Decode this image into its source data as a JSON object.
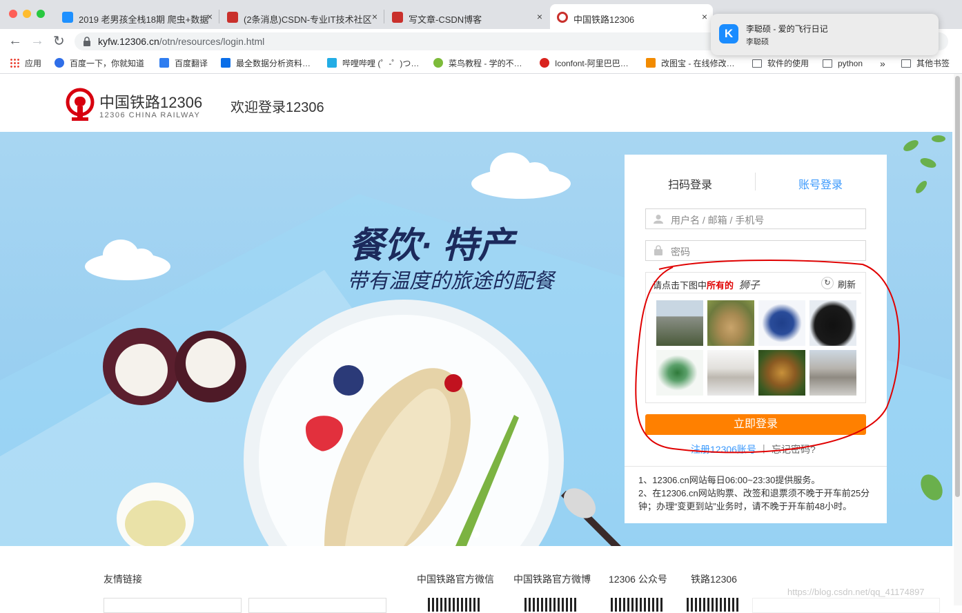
{
  "browser": {
    "tabs": [
      {
        "title": "2019 老男孩全栈18期 爬虫+数据",
        "close": "×",
        "favicon_color": "#1e90ff"
      },
      {
        "title": "(2条消息)CSDN-专业IT技术社区",
        "close": "×",
        "favicon_color": "#c9302c"
      },
      {
        "title": "写文章-CSDN博客",
        "close": "×",
        "favicon_color": "#c9302c"
      },
      {
        "title": "中国铁路12306",
        "close": "×",
        "favicon_color": "#c9302c"
      }
    ],
    "url_host": "kyfw.12306.cn",
    "url_path": "/otn/resources/login.html",
    "bookmarks": [
      {
        "label": "应用",
        "icon": "apps-grid-icon"
      },
      {
        "label": "百度一下，你就知道",
        "icon": "baidu-paw-icon"
      },
      {
        "label": "百度翻译",
        "icon": "translate-icon"
      },
      {
        "label": "最全数据分析资料…",
        "icon": "zhihu-icon"
      },
      {
        "label": "哔哩哔哩 (゜-゜)つ…",
        "icon": "bilibili-icon"
      },
      {
        "label": "菜鸟教程 - 学的不…",
        "icon": "runoob-icon"
      },
      {
        "label": "Iconfont-阿里巴巴…",
        "icon": "iconfont-icon"
      },
      {
        "label": "改图宝 - 在线修改…",
        "icon": "gaitubao-icon"
      },
      {
        "label": "软件的使用",
        "icon": "folder-icon"
      },
      {
        "label": "python",
        "icon": "folder-icon"
      }
    ],
    "bookmarks_more": "»",
    "other_bookmarks": "其他书签"
  },
  "notification": {
    "title": "李聪硕 - 爱的飞行日记",
    "subtitle": "李聪硕",
    "app_icon_letter": "K"
  },
  "header": {
    "logo_cn": "中国铁路12306",
    "logo_en": "12306 CHINA RAILWAY",
    "welcome": "欢迎登录12306"
  },
  "banner": {
    "headline": "餐饮· 特产",
    "tagline": "带有温度的旅途的配餐"
  },
  "login": {
    "tab_qr": "扫码登录",
    "tab_account": "账号登录",
    "username_placeholder": "用户名 / 邮箱 / 手机号",
    "password_placeholder": "密码",
    "captcha_prompt": "请点击下图中",
    "captcha_emph": "所有的",
    "captcha_target": "狮子",
    "refresh": "刷新",
    "submit": "立即登录",
    "register": "注册12306账号",
    "divider": "|",
    "forgot": "忘记密码?",
    "notices": [
      "1、12306.cn网站每日06:00~23:30提供服务。",
      "2、在12306.cn网站购票、改签和退票须不晚于开车前25分",
      "钟；办理“变更到站”业务时，请不晚于开车前48小时。"
    ]
  },
  "footer": {
    "links_title": "友情链接",
    "wechat": "中国铁路官方微信",
    "weibo": "中国铁路官方微博",
    "public": "12306 公众号",
    "app": "铁路12306"
  },
  "watermark": "https://blog.csdn.net/qq_41174897",
  "colors": {
    "brand_red": "#d7000f",
    "accent_blue": "#3b99fc",
    "login_orange": "#ff8000",
    "annotation_red": "#e00000"
  }
}
